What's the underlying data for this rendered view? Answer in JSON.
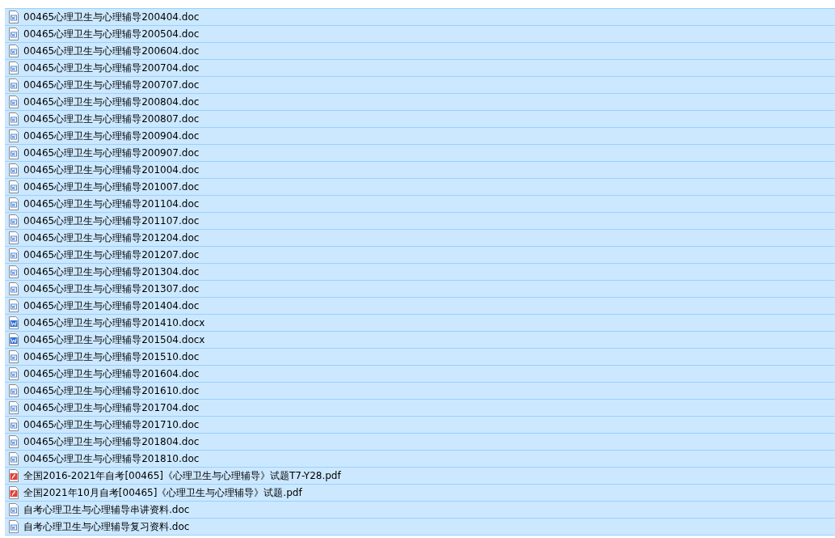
{
  "files": [
    {
      "name": "00465心理卫生与心理辅导200404.doc",
      "kind": "doc",
      "selected": true
    },
    {
      "name": "00465心理卫生与心理辅导200504.doc",
      "kind": "doc",
      "selected": true
    },
    {
      "name": "00465心理卫生与心理辅导200604.doc",
      "kind": "doc",
      "selected": true
    },
    {
      "name": "00465心理卫生与心理辅导200704.doc",
      "kind": "doc",
      "selected": true
    },
    {
      "name": "00465心理卫生与心理辅导200707.doc",
      "kind": "doc",
      "selected": true
    },
    {
      "name": "00465心理卫生与心理辅导200804.doc",
      "kind": "doc",
      "selected": true
    },
    {
      "name": "00465心理卫生与心理辅导200807.doc",
      "kind": "doc",
      "selected": true
    },
    {
      "name": "00465心理卫生与心理辅导200904.doc",
      "kind": "doc",
      "selected": true
    },
    {
      "name": "00465心理卫生与心理辅导200907.doc",
      "kind": "doc",
      "selected": true
    },
    {
      "name": "00465心理卫生与心理辅导201004.doc",
      "kind": "doc",
      "selected": true
    },
    {
      "name": "00465心理卫生与心理辅导201007.doc",
      "kind": "doc",
      "selected": true
    },
    {
      "name": "00465心理卫生与心理辅导201104.doc",
      "kind": "doc",
      "selected": true
    },
    {
      "name": "00465心理卫生与心理辅导201107.doc",
      "kind": "doc",
      "selected": true
    },
    {
      "name": "00465心理卫生与心理辅导201204.doc",
      "kind": "doc",
      "selected": true
    },
    {
      "name": "00465心理卫生与心理辅导201207.doc",
      "kind": "doc",
      "selected": true
    },
    {
      "name": "00465心理卫生与心理辅导201304.doc",
      "kind": "doc",
      "selected": true
    },
    {
      "name": "00465心理卫生与心理辅导201307.doc",
      "kind": "doc",
      "selected": true
    },
    {
      "name": "00465心理卫生与心理辅导201404.doc",
      "kind": "doc",
      "selected": true
    },
    {
      "name": "00465心理卫生与心理辅导201410.docx",
      "kind": "docx",
      "selected": true
    },
    {
      "name": "00465心理卫生与心理辅导201504.docx",
      "kind": "docx",
      "selected": true
    },
    {
      "name": "00465心理卫生与心理辅导201510.doc",
      "kind": "doc",
      "selected": true
    },
    {
      "name": "00465心理卫生与心理辅导201604.doc",
      "kind": "doc",
      "selected": true
    },
    {
      "name": "00465心理卫生与心理辅导201610.doc",
      "kind": "doc",
      "selected": true
    },
    {
      "name": "00465心理卫生与心理辅导201704.doc",
      "kind": "doc",
      "selected": true
    },
    {
      "name": "00465心理卫生与心理辅导201710.doc",
      "kind": "doc",
      "selected": true
    },
    {
      "name": "00465心理卫生与心理辅导201804.doc",
      "kind": "doc",
      "selected": true
    },
    {
      "name": "00465心理卫生与心理辅导201810.doc",
      "kind": "doc",
      "selected": true
    },
    {
      "name": "全国2016-2021年自考[00465]《心理卫生与心理辅导》试题T7-Y28.pdf",
      "kind": "pdf",
      "selected": true
    },
    {
      "name": "全国2021年10月自考[00465]《心理卫生与心理辅导》试题.pdf",
      "kind": "pdf",
      "selected": true
    },
    {
      "name": "自考心理卫生与心理辅导串讲资料.doc",
      "kind": "doc",
      "selected": true
    },
    {
      "name": "自考心理卫生与心理辅导复习资料.doc",
      "kind": "doc",
      "selected": true
    }
  ]
}
